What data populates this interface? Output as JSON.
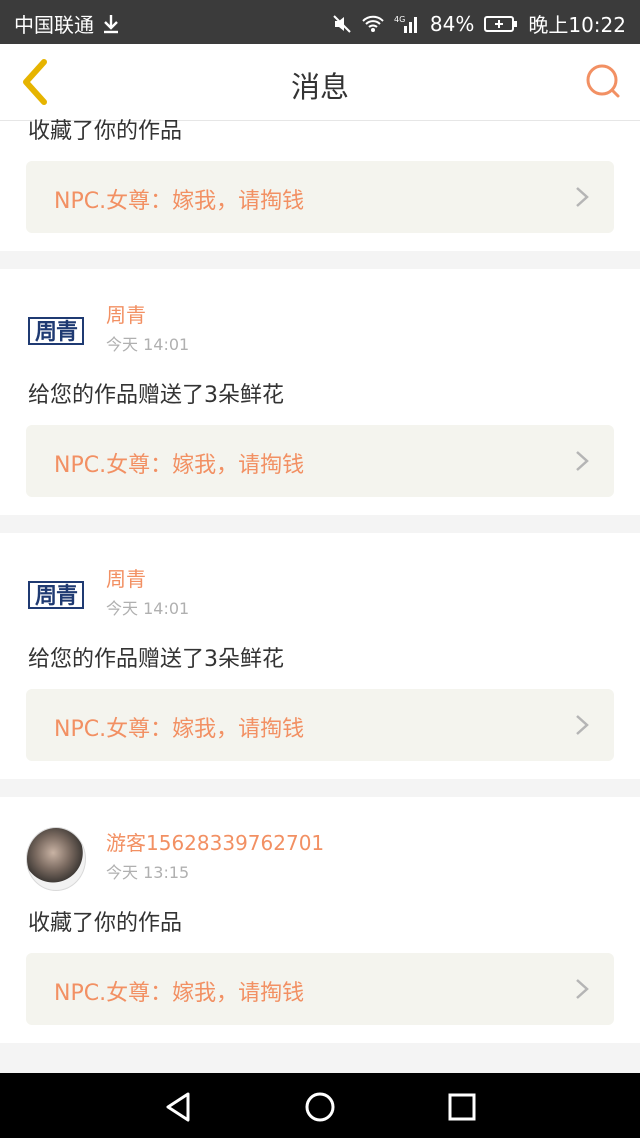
{
  "status_bar": {
    "carrier": "中国联通",
    "battery_percent": "84%",
    "time": "晚上10:22",
    "network": "4G"
  },
  "navbar": {
    "title": "消息"
  },
  "colors": {
    "accent": "#f29063",
    "back_icon": "#e6b400",
    "search_icon": "#f29063"
  },
  "messages": [
    {
      "text": "收藏了你的作品",
      "ref": "NPC.女尊：嫁我，请掏钱"
    },
    {
      "user": "周青",
      "avatar_text": "周青",
      "time": "今天 14:01",
      "text": "给您的作品赠送了3朵鲜花",
      "ref": "NPC.女尊：嫁我，请掏钱"
    },
    {
      "user": "周青",
      "avatar_text": "周青",
      "time": "今天 14:01",
      "text": "给您的作品赠送了3朵鲜花",
      "ref": "NPC.女尊：嫁我，请掏钱"
    },
    {
      "user": "游客15628339762701",
      "time": "今天 13:15",
      "text": "收藏了你的作品",
      "ref": "NPC.女尊：嫁我，请掏钱"
    }
  ],
  "system_nav": {
    "back": "back-icon",
    "home": "home-icon",
    "recents": "recents-icon"
  }
}
